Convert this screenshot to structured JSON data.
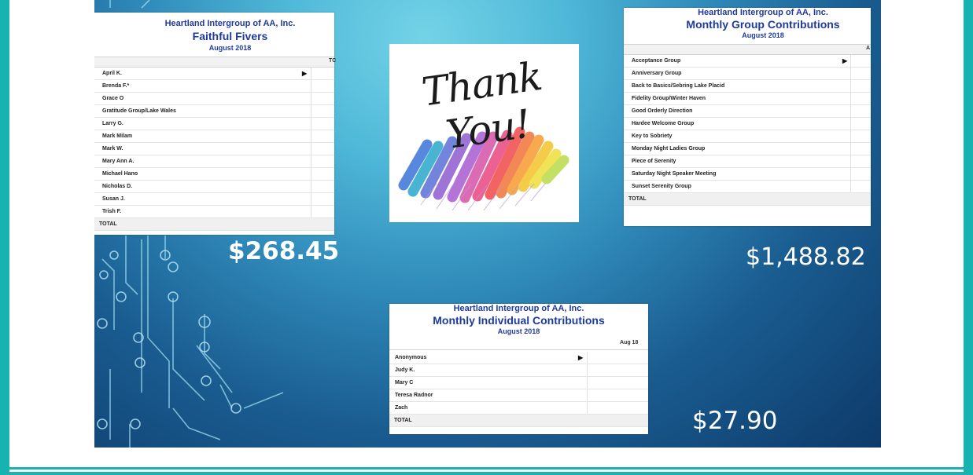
{
  "colors": {
    "frame": "#17b3b0",
    "header_text": "#1f3a9e",
    "amount_text": "#ffffff"
  },
  "faithful_fivers": {
    "org": "Heartland Intergroup of AA, Inc.",
    "title": "Faithful Fivers",
    "period": "August 2018",
    "column_header": "TC",
    "rows": [
      "April K.",
      "Brenda F.*",
      "Grace O",
      "Gratitude Group/Lake Wales",
      "Larry G.",
      "Mark Milam",
      "Mark W.",
      "Mary Ann A.",
      "Michael Hano",
      "Nicholas D.",
      "Susan J.",
      "Trish F."
    ],
    "total_label": "TOTAL",
    "amount": "$268.45"
  },
  "thank_you": {
    "text": "Thank You!"
  },
  "group_contributions": {
    "org": "Heartland Intergroup of AA, Inc.",
    "title": "Monthly Group Contributions",
    "period": "August 2018",
    "column_header": "A",
    "rows": [
      "Acceptance Group",
      "Anniversary Group",
      "Back to Basics/Sebring Lake Placid",
      "Fidelity Group/Winter Haven",
      "Good Orderly Direction",
      "Hardee Welcome Group",
      "Key to Sobriety",
      "Monday Night Ladies Group",
      "Piece of Serenity",
      "Saturday Night Speaker Meeting",
      "Sunset Serenity Group"
    ],
    "total_label": "TOTAL",
    "amount": "$1,488.82"
  },
  "individual_contributions": {
    "org": "Heartland Intergroup of AA, Inc.",
    "title": "Monthly Individual Contributions",
    "period": "August 2018",
    "column_header": "Aug 18",
    "rows": [
      "Anonymous",
      "Judy K.",
      "Mary C",
      "Teresa Radnor",
      "Zach"
    ],
    "total_label": "TOTAL",
    "amount": "$27.90"
  }
}
